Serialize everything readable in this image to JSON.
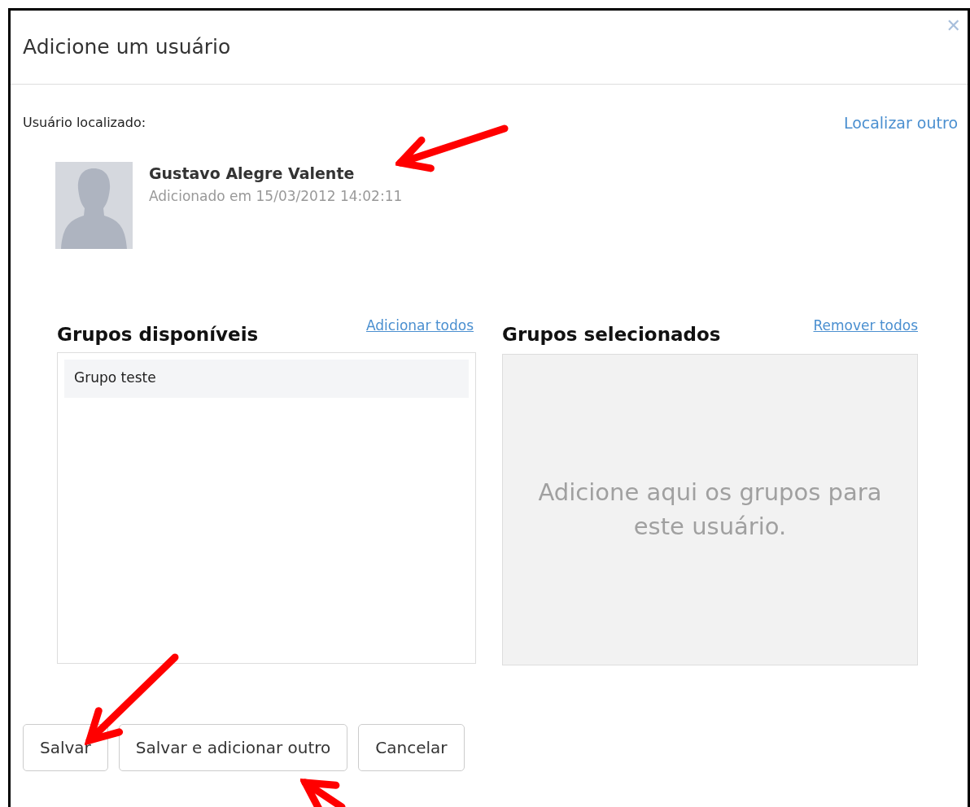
{
  "dialog": {
    "title": "Adicione um usuário",
    "close_icon": "✕"
  },
  "found_user": {
    "label": "Usuário localizado:",
    "link": "Localizar outro",
    "name": "Gustavo Alegre Valente",
    "added": "Adicionado em 15/03/2012 14:02:11"
  },
  "available_groups": {
    "title": "Grupos disponíveis",
    "link": "Adicionar todos",
    "items": [
      {
        "label": "Grupo teste",
        "selected": false
      }
    ]
  },
  "selected_groups": {
    "title": "Grupos selecionados",
    "link": "Remover todos",
    "placeholder": "Adicione aqui os grupos para este usuário."
  },
  "buttons": [
    "Salvar",
    "Salvar e adicionar outro",
    "Cancelar"
  ]
}
